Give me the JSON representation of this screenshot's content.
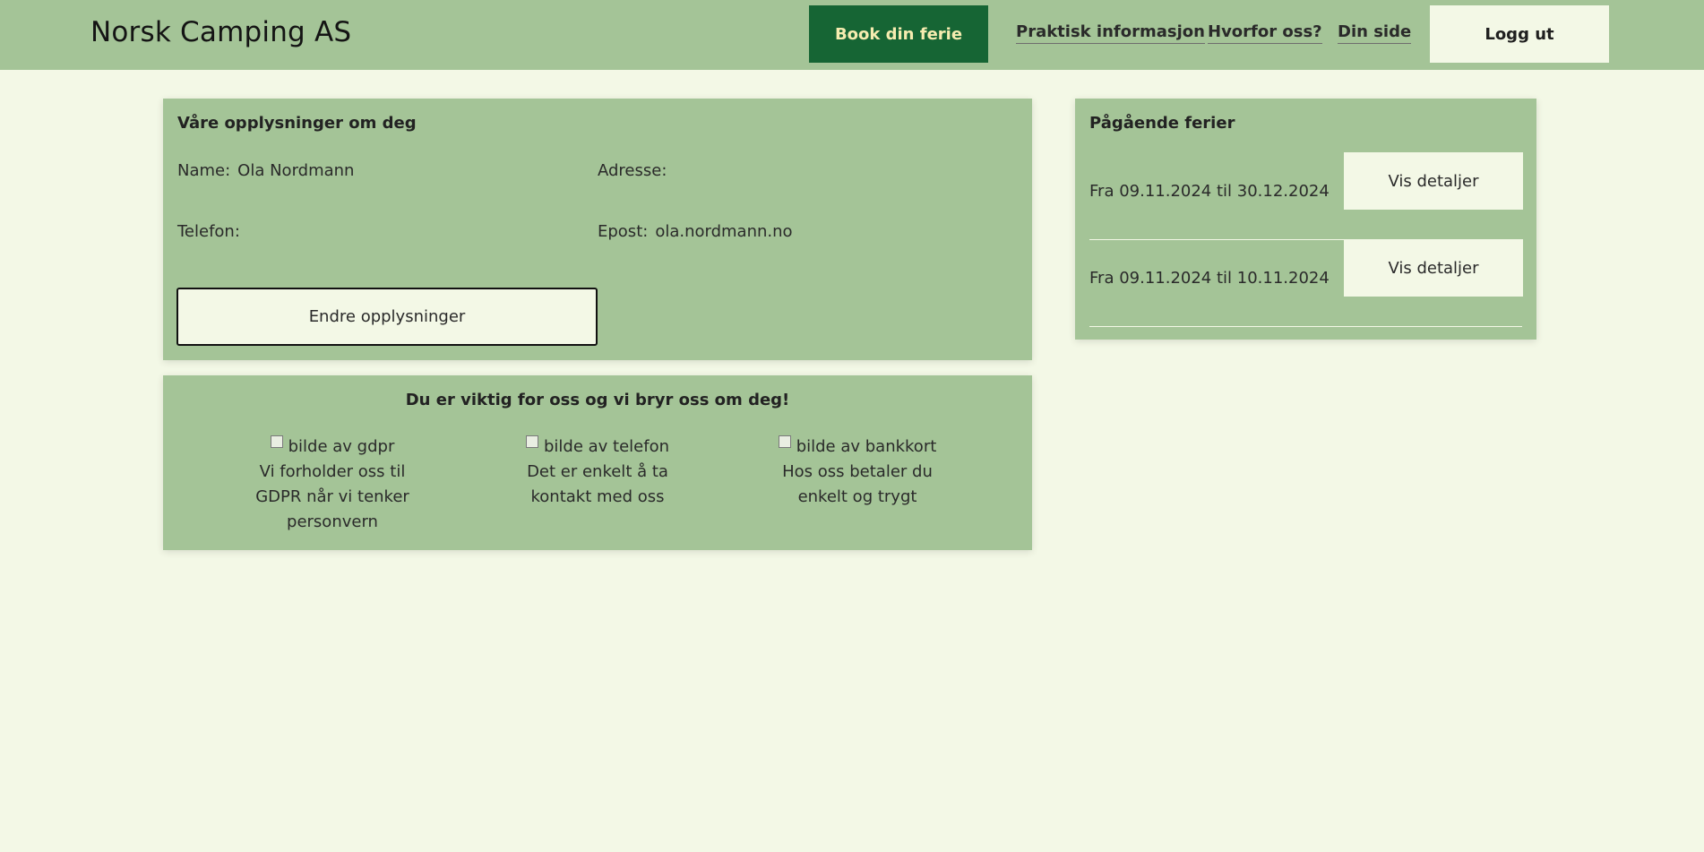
{
  "header": {
    "brand": "Norsk Camping AS",
    "book_button": "Book din ferie",
    "nav": [
      "Praktisk informasjon",
      "Hvorfor oss?",
      "Din side"
    ],
    "logout_button": "Logg ut"
  },
  "profile": {
    "title": "Våre opplysninger om deg",
    "name_label": "Name:",
    "name_value": "Ola Nordmann",
    "address_label": "Adresse:",
    "address_value": "",
    "phone_label": "Telefon:",
    "phone_value": "",
    "email_label": "Epost:",
    "email_value": "ola.nordmann.no",
    "edit_button": "Endre opplysninger"
  },
  "care": {
    "title": "Du er viktig for oss og vi bryr oss om deg!",
    "features": [
      {
        "img_alt": "bilde av gdpr",
        "text": "Vi forholder oss til GDPR når vi tenker personvern"
      },
      {
        "img_alt": "bilde av telefon",
        "text": "Det er enkelt å ta kontakt med oss"
      },
      {
        "img_alt": "bilde av bankkort",
        "text": "Hos oss betaler du enkelt og trygt"
      }
    ]
  },
  "trips": {
    "title": "Pågående ferier",
    "items": [
      {
        "text": "Fra 09.11.2024 til 30.12.2024",
        "button": "Vis detaljer"
      },
      {
        "text": "Fra 09.11.2024 til 10.11.2024",
        "button": "Vis detaljer"
      }
    ]
  },
  "colors": {
    "page_bg": "#f3f8e6",
    "panel_bg": "#a4c497",
    "book_button_bg": "#166534",
    "book_button_text": "#f6ecb0"
  }
}
